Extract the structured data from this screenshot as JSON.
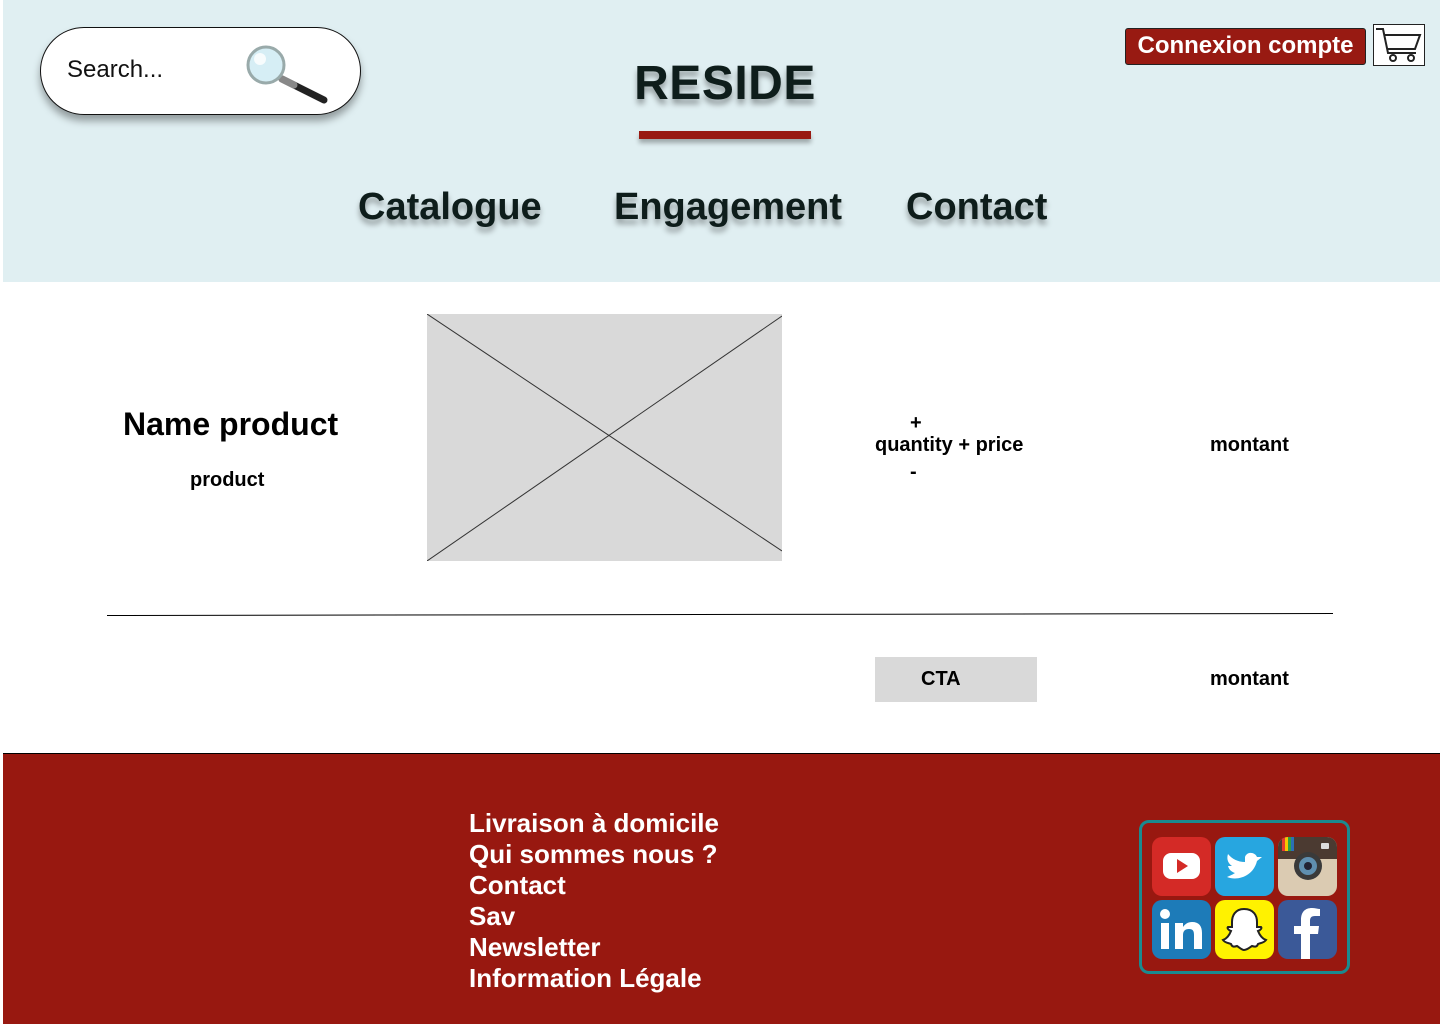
{
  "header": {
    "search": {
      "placeholder": "Search..."
    },
    "logo": "RESIDE",
    "login_label": "Connexion compte",
    "nav": [
      "Catalogue",
      "Engagement",
      "Contact"
    ]
  },
  "product": {
    "name": "Name product",
    "subtitle": "product",
    "quantity": {
      "plus": "+",
      "label": "quantity + price",
      "minus": "-"
    },
    "amount": "montant"
  },
  "summary": {
    "cta_label": "CTA",
    "amount": "montant"
  },
  "footer": {
    "links": [
      "Livraison à domicile",
      "Qui sommes nous ?",
      "Contact",
      "Sav",
      "Newsletter",
      "Information Légale"
    ],
    "social": [
      "youtube-icon",
      "twitter-icon",
      "instagram-icon",
      "linkedin-icon",
      "snapchat-icon",
      "facebook-icon"
    ]
  },
  "colors": {
    "brand_red": "#981a12",
    "header_bg": "#e0eff2",
    "footer_bg": "#981810",
    "social_border": "#1a8a8f"
  }
}
